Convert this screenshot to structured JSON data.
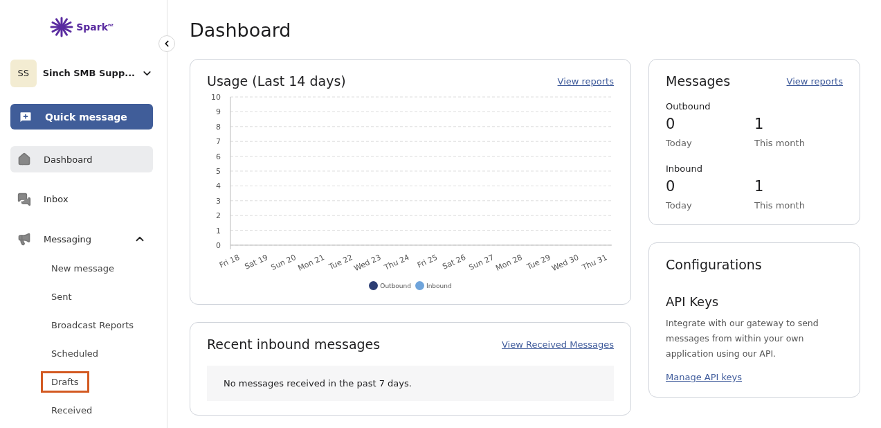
{
  "sidebar": {
    "logo": {
      "text": "Spark",
      "suffix": "nz"
    },
    "account": {
      "initials": "SS",
      "name": "Sinch SMB Supp..."
    },
    "quick_message": "Quick message",
    "items": [
      {
        "label": "Dashboard",
        "selected": true
      },
      {
        "label": "Inbox",
        "selected": false
      },
      {
        "label": "Messaging",
        "selected": false,
        "expanded": true,
        "children": [
          {
            "label": "New message",
            "highlighted": false
          },
          {
            "label": "Sent",
            "highlighted": false
          },
          {
            "label": "Broadcast Reports",
            "highlighted": false
          },
          {
            "label": "Scheduled",
            "highlighted": false
          },
          {
            "label": "Drafts",
            "highlighted": true
          },
          {
            "label": "Received",
            "highlighted": false
          }
        ]
      }
    ]
  },
  "page_title": "Dashboard",
  "usage": {
    "title": "Usage (Last 14 days)",
    "link": "View reports",
    "chart_data": {
      "type": "line",
      "categories": [
        "Fri 18",
        "Sat 19",
        "Sun 20",
        "Mon 21",
        "Tue 22",
        "Wed 23",
        "Thu 24",
        "Fri 25",
        "Sat 26",
        "Sun 27",
        "Mon 28",
        "Tue 29",
        "Wed 30",
        "Thu 31"
      ],
      "series": [
        {
          "name": "Outbound",
          "color": "#2c3e74",
          "values": [
            null,
            null,
            null,
            null,
            null,
            null,
            null,
            null,
            null,
            null,
            null,
            null,
            null,
            null
          ]
        },
        {
          "name": "Inbound",
          "color": "#6fa4db",
          "values": [
            null,
            null,
            null,
            null,
            null,
            null,
            null,
            null,
            null,
            null,
            null,
            null,
            null,
            null
          ]
        }
      ],
      "ylim": [
        0,
        10
      ],
      "grid": true,
      "yticks": [
        0,
        1,
        2,
        3,
        4,
        5,
        6,
        7,
        8,
        9,
        10
      ]
    }
  },
  "recent_inbound": {
    "title": "Recent inbound messages",
    "link": "View Received Messages",
    "empty_text": "No messages received in the past 7 days."
  },
  "messages": {
    "title": "Messages",
    "link": "View reports",
    "groups": [
      {
        "label": "Outbound",
        "stats": [
          {
            "value": "0",
            "caption": "Today"
          },
          {
            "value": "1",
            "caption": "This month"
          }
        ]
      },
      {
        "label": "Inbound",
        "stats": [
          {
            "value": "0",
            "caption": "Today"
          },
          {
            "value": "1",
            "caption": "This month"
          }
        ]
      }
    ]
  },
  "configurations": {
    "title": "Configurations",
    "subtitle": "API Keys",
    "description": "Integrate with our gateway to send messages from within your own application using our API.",
    "link": "Manage API keys"
  }
}
